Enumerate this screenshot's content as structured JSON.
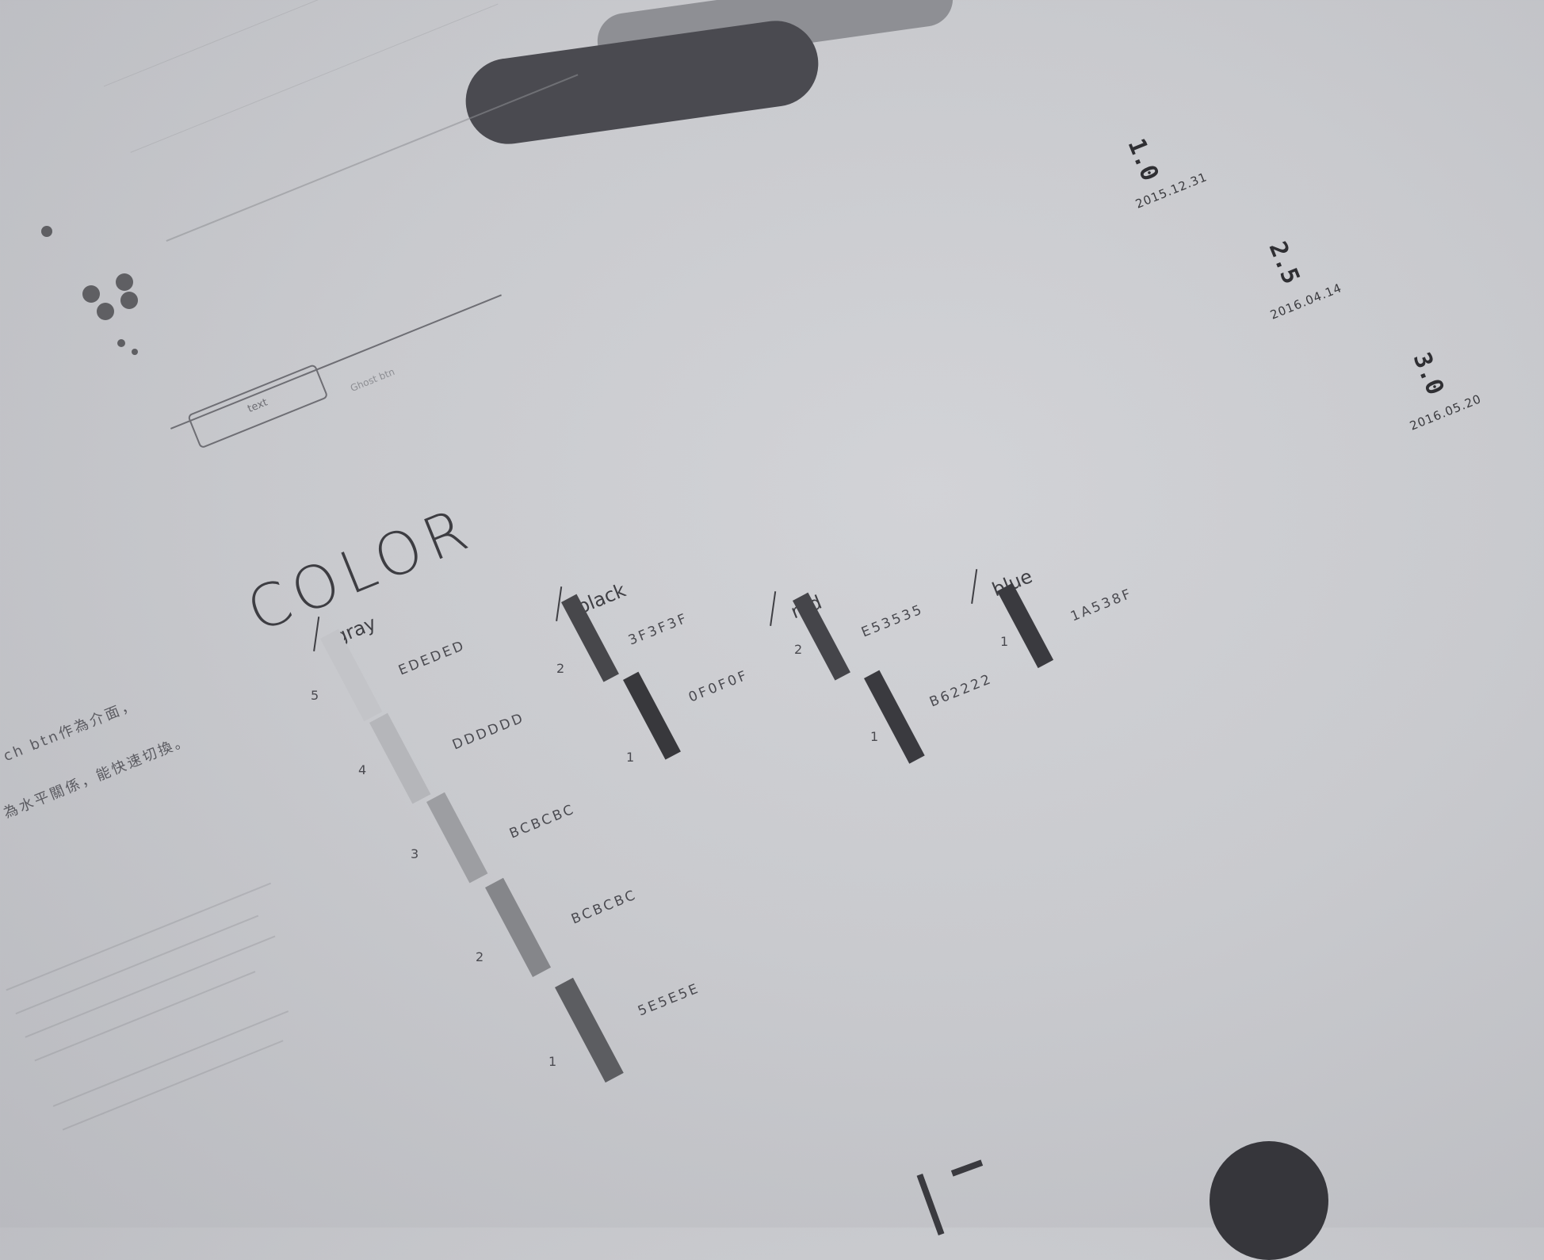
{
  "colors": {
    "paper": "#cbccd0",
    "ink_dark": "#36363b",
    "ink_mid": "#5f5f63"
  },
  "heading": "COLOR",
  "categories": {
    "gray": "gray",
    "black": "black",
    "red": "red",
    "blue": "blue"
  },
  "gray_swatches": [
    {
      "index": "5",
      "hex": "EDEDED",
      "color": "#c3c4c8"
    },
    {
      "index": "4",
      "hex": "DDDDDD",
      "color": "#b5b6ba"
    },
    {
      "index": "3",
      "hex": "BCBCBC",
      "color": "#9d9ea2"
    },
    {
      "index": "2",
      "hex": "BCBCBC",
      "color": "#85868a"
    },
    {
      "index": "1",
      "hex": "5E5E5E",
      "color": "#5c5d61"
    }
  ],
  "black_swatches": [
    {
      "index": "2",
      "hex": "3F3F3F",
      "color": "#47474b"
    },
    {
      "index": "1",
      "hex": "0F0F0F",
      "color": "#38383c"
    }
  ],
  "red_swatches": [
    {
      "index": "2",
      "hex": "E53535",
      "color": "#45454a"
    },
    {
      "index": "1",
      "hex": "B62222",
      "color": "#3a3a3f"
    }
  ],
  "blue_swatches": [
    {
      "index": "1",
      "hex": "1A538F",
      "color": "#3a3a3f"
    }
  ],
  "versions": [
    {
      "version": "1.0",
      "date": "2015.12.31"
    },
    {
      "version": "2.5",
      "date": "2016.04.14"
    },
    {
      "version": "3.0",
      "date": "2016.05.20"
    }
  ],
  "ui_samples": {
    "button_text": "text",
    "ghost_btn": "Ghost btn"
  },
  "body_text": {
    "line1": "ch btn作為介面，",
    "line2": "為水平關係，能快速切換。"
  }
}
